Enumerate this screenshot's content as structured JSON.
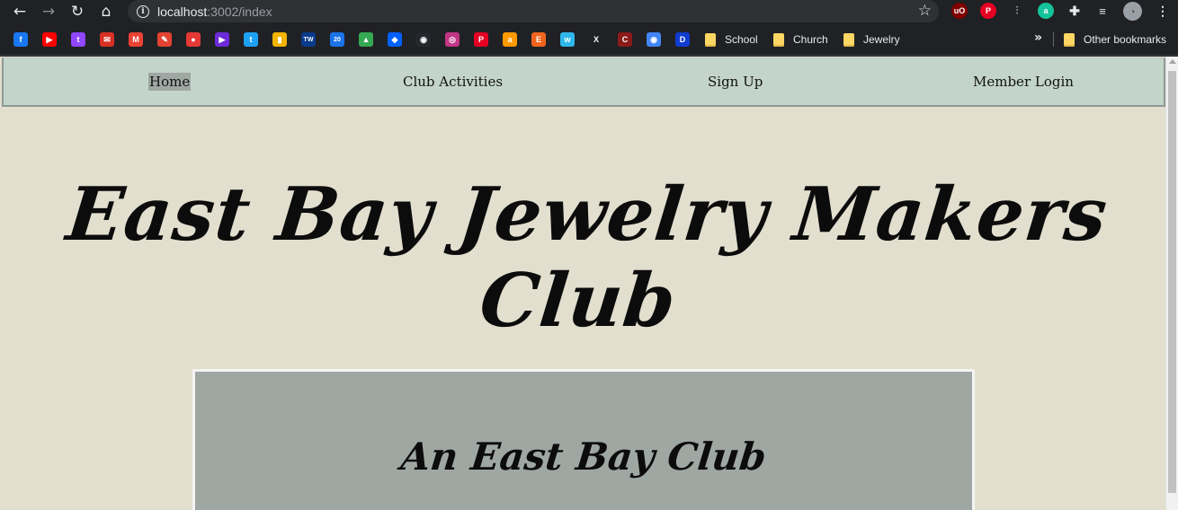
{
  "browser": {
    "url_host": "localhost",
    "url_path": ":3002/index",
    "extensions": [
      {
        "name": "ublock-icon",
        "glyph": "uO",
        "color": "#800000"
      },
      {
        "name": "pinterest-icon",
        "glyph": "P",
        "color": "#e60023"
      },
      {
        "name": "equalizer-icon",
        "glyph": "|||",
        "color": "#5f6368"
      },
      {
        "name": "grammarly-icon",
        "glyph": "a",
        "color": "#15c39a"
      }
    ]
  },
  "bookmarks": {
    "icons": [
      {
        "name": "facebook-icon",
        "glyph": "f",
        "color": "#1877f2"
      },
      {
        "name": "youtube-icon",
        "glyph": "▶",
        "color": "#ff0000"
      },
      {
        "name": "twitch-icon",
        "glyph": "t",
        "color": "#9146ff"
      },
      {
        "name": "mail-icon",
        "glyph": "✉",
        "color": "#d93025"
      },
      {
        "name": "gmail-icon",
        "glyph": "M",
        "color": "#ea4335"
      },
      {
        "name": "todoist-icon",
        "glyph": "✎",
        "color": "#e44332"
      },
      {
        "name": "tomato-icon",
        "glyph": "●",
        "color": "#e53935"
      },
      {
        "name": "play-icon",
        "glyph": "▶",
        "color": "#6c2bd9"
      },
      {
        "name": "twitter-icon",
        "glyph": "t",
        "color": "#1da1f2"
      },
      {
        "name": "gift-icon",
        "glyph": "▮",
        "color": "#f2b400"
      },
      {
        "name": "weather-channel-icon",
        "glyph": "TW",
        "color": "#0a3a8c"
      },
      {
        "name": "calendar-icon",
        "glyph": "20",
        "color": "#1a73e8"
      },
      {
        "name": "google-drive-icon",
        "glyph": "▲",
        "color": "#34a853"
      },
      {
        "name": "dropbox-icon",
        "glyph": "◆",
        "color": "#0061ff"
      },
      {
        "name": "github-icon",
        "glyph": "◉",
        "color": "#24292e"
      },
      {
        "name": "instagram-icon",
        "glyph": "◎",
        "color": "#c13584"
      },
      {
        "name": "pinterest-bookmark-icon",
        "glyph": "P",
        "color": "#e60023"
      },
      {
        "name": "amazon-icon",
        "glyph": "a",
        "color": "#ff9900"
      },
      {
        "name": "etsy-icon",
        "glyph": "E",
        "color": "#f1641e"
      },
      {
        "name": "wish-icon",
        "glyph": "w",
        "color": "#2fb7ec"
      },
      {
        "name": "x-icon",
        "glyph": "X",
        "color": "#202124"
      },
      {
        "name": "canvas-icon",
        "glyph": "C",
        "color": "#8b1a1a"
      },
      {
        "name": "chrome-icon",
        "glyph": "◉",
        "color": "#4285f4"
      },
      {
        "name": "disney-icon",
        "glyph": "D",
        "color": "#113ccf"
      }
    ],
    "folders": [
      "School",
      "Church",
      "Jewelry"
    ],
    "other_label": "Other bookmarks",
    "folder_color": "#fdd663"
  },
  "nav": {
    "items": [
      "Home",
      "Club Activities",
      "Sign Up",
      "Member Login"
    ],
    "active": "Home"
  },
  "hero": {
    "title": "East Bay Jewelry Makers Club"
  },
  "card": {
    "title": "An East Bay Club"
  },
  "colors": {
    "page_bg": "#e2dfcf",
    "nav_bg": "#c3d4cb",
    "card_bg": "#9fa7a3",
    "active_highlight": "#9fa7a3"
  }
}
